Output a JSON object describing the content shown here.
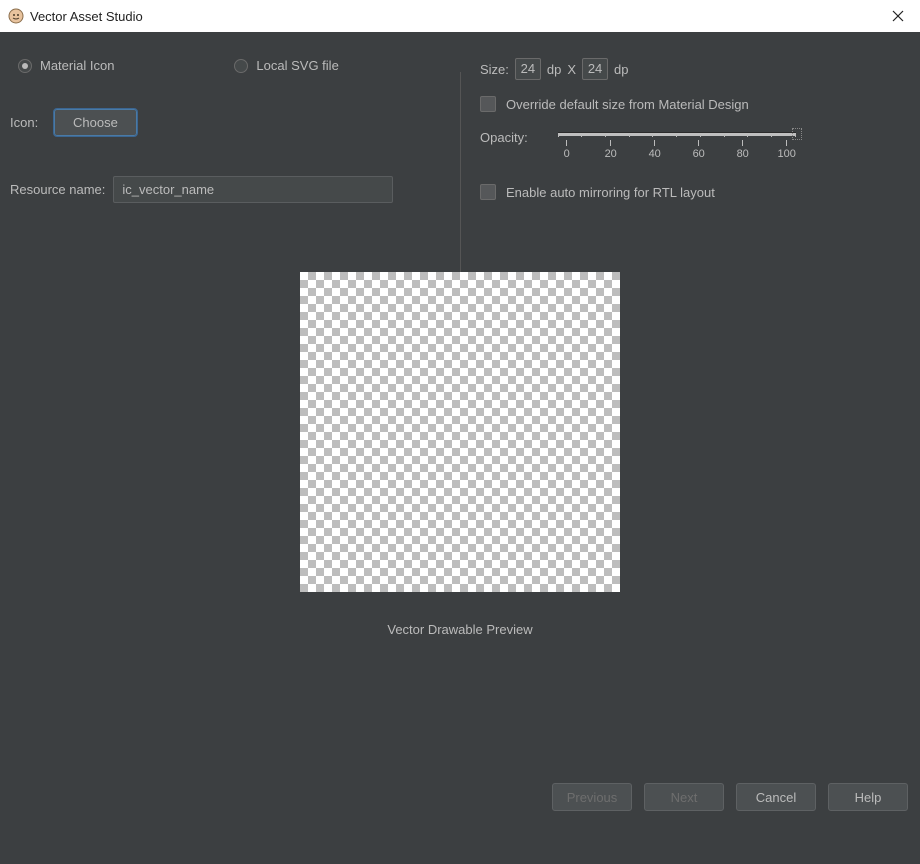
{
  "window": {
    "title": "Vector Asset Studio"
  },
  "left": {
    "source": {
      "material_label": "Material Icon",
      "svg_label": "Local SVG file",
      "selected": "material"
    },
    "icon_label": "Icon:",
    "choose_button": "Choose",
    "resource_name_label": "Resource name:",
    "resource_name_value": "ic_vector_name"
  },
  "right": {
    "size_label": "Size:",
    "size_width": "24",
    "size_unit_1": "dp",
    "size_sep": "X",
    "size_height": "24",
    "size_unit_2": "dp",
    "override_label": "Override default size from Material Design",
    "override_checked": false,
    "opacity_label": "Opacity:",
    "opacity_ticks": [
      "0",
      "20",
      "40",
      "60",
      "80",
      "100"
    ],
    "opacity_value": 100,
    "rtl_label": "Enable auto mirroring for RTL layout",
    "rtl_checked": false
  },
  "preview": {
    "label": "Vector Drawable Preview"
  },
  "footer": {
    "previous": "Previous",
    "next": "Next",
    "cancel": "Cancel",
    "help": "Help"
  }
}
